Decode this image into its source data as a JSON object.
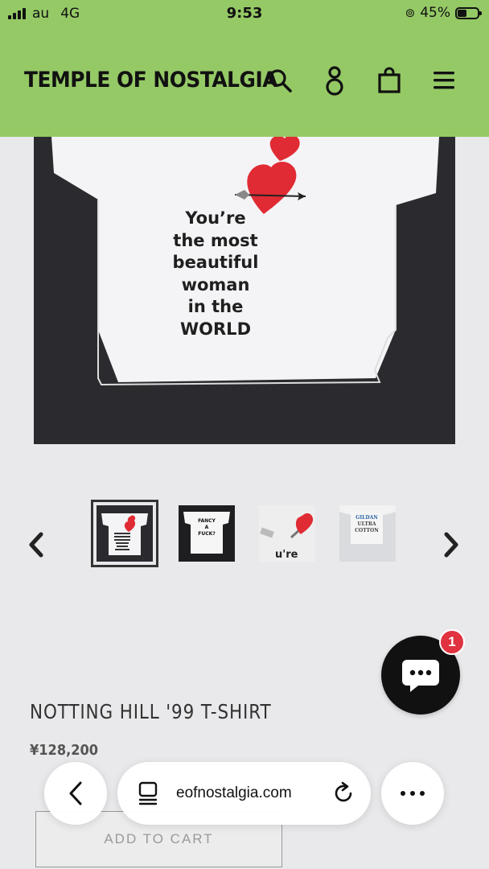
{
  "status_bar": {
    "carrier": "au",
    "network": "4G",
    "time": "9:53",
    "battery": "45%",
    "battery_level": 0.45
  },
  "header": {
    "logo": "TEMPLE OF NOSTALGIA",
    "icons": [
      "search-icon",
      "account-icon",
      "cart-icon",
      "menu-icon"
    ],
    "background": "#95c966"
  },
  "product": {
    "image_text": [
      "You’re",
      "the most",
      "beautiful",
      "woman",
      "in the",
      "WORLD"
    ],
    "title": "NOTTING HILL '99 T-SHIRT",
    "price": "¥128,200",
    "add_to_cart": "ADD TO CART"
  },
  "thumbnails": {
    "active_index": 0,
    "thumb2_text": [
      "FANCY",
      "A",
      "FUCK?"
    ],
    "thumb3_text": "u're",
    "thumb4_text": [
      "GILDAN",
      "ULTRA",
      "COTTON"
    ]
  },
  "chat": {
    "badge_count": "1",
    "icon": "chat-bubble-icon"
  },
  "browser": {
    "url": "eofnostalgia.com",
    "icons": [
      "back-icon",
      "tabs-icon",
      "reload-icon",
      "more-icon"
    ]
  }
}
